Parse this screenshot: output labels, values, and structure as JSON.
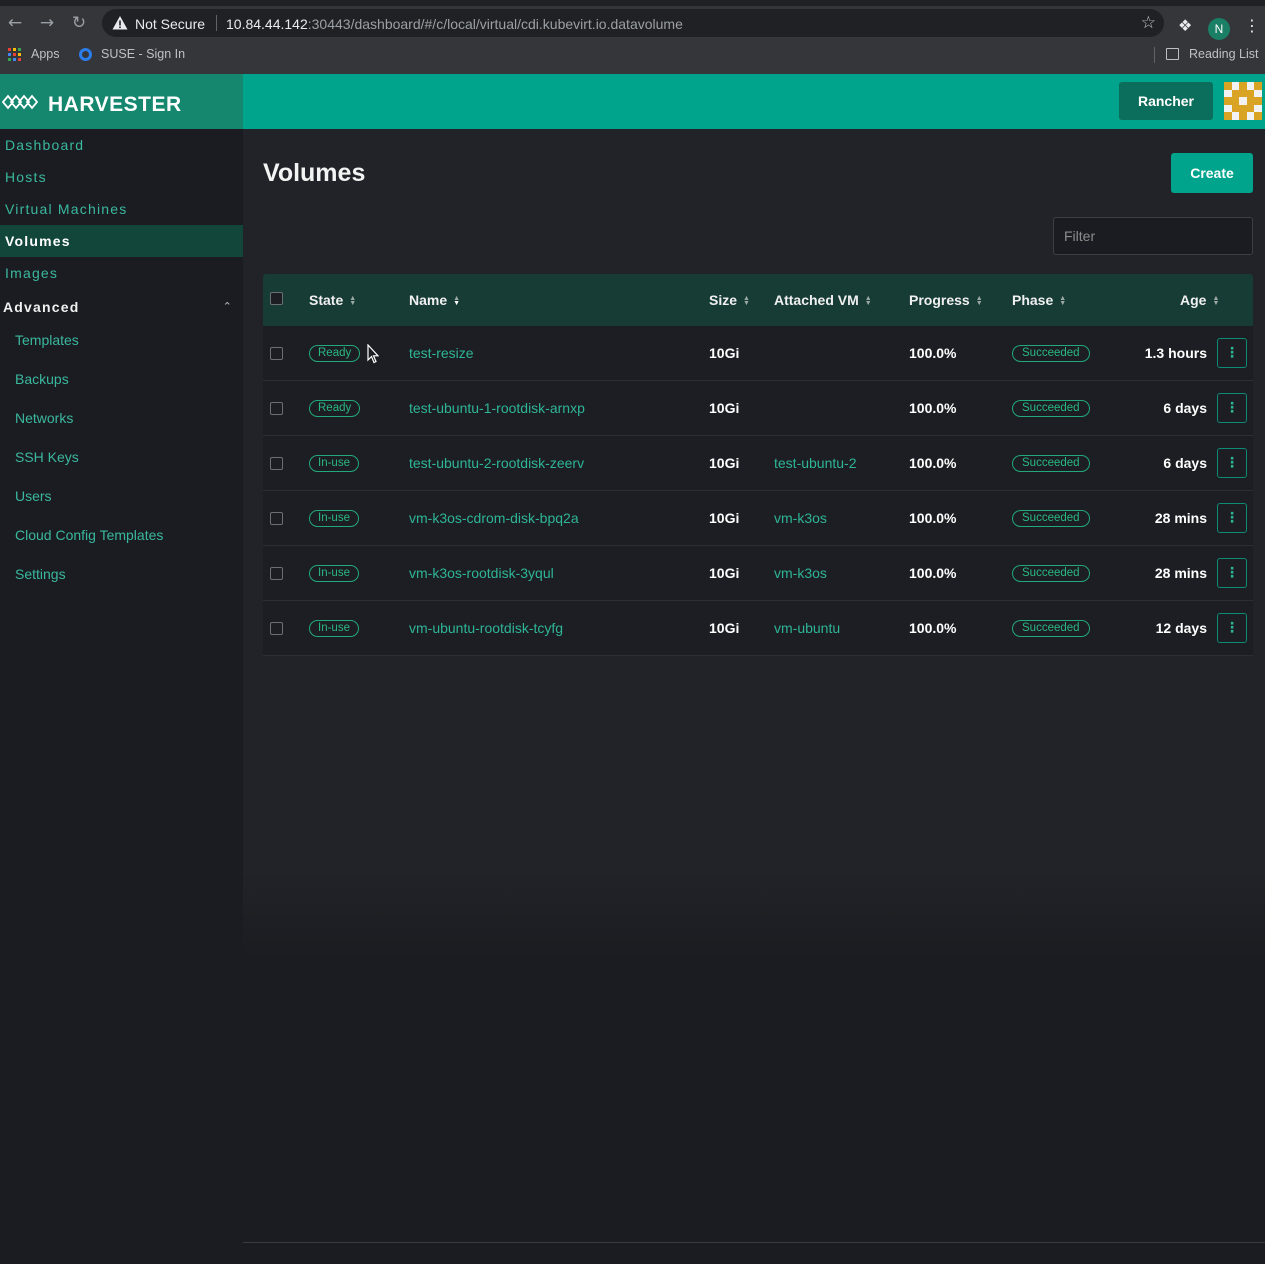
{
  "browser": {
    "security_label": "Not Secure",
    "url_host": "10.84.44.142",
    "url_rest": ":30443/dashboard/#/c/local/virtual/cdi.kubevirt.io.datavolume",
    "profile_initial": "N",
    "bookmarks": {
      "apps": "Apps",
      "suse": "SUSE - Sign In",
      "reading_list": "Reading List"
    },
    "icons": [
      "back-arrow-icon",
      "forward-arrow-icon",
      "reload-icon",
      "warning-icon",
      "star-icon",
      "extensions-icon",
      "menu-dots-icon",
      "apps-grid-icon",
      "reading-list-icon"
    ]
  },
  "app": {
    "brand": "HARVESTER",
    "rancher_label": "Rancher",
    "accent_color": "#00a38b"
  },
  "sidebar": {
    "items": [
      {
        "label": "Dashboard"
      },
      {
        "label": "Hosts"
      },
      {
        "label": "Virtual Machines"
      },
      {
        "label": "Volumes",
        "active": true
      },
      {
        "label": "Images"
      }
    ],
    "group": {
      "label": "Advanced",
      "items": [
        "Templates",
        "Backups",
        "Networks",
        "SSH Keys",
        "Users",
        "Cloud Config Templates",
        "Settings"
      ]
    }
  },
  "page": {
    "title": "Volumes",
    "create_label": "Create",
    "filter_placeholder": "Filter"
  },
  "table": {
    "columns": [
      "State",
      "Name",
      "Size",
      "Attached VM",
      "Progress",
      "Phase",
      "Age"
    ],
    "rows": [
      {
        "state": "Ready",
        "name": "test-resize",
        "size": "10Gi",
        "attached_vm": "",
        "progress": "100.0%",
        "phase": "Succeeded",
        "age": "1.3 hours"
      },
      {
        "state": "Ready",
        "name": "test-ubuntu-1-rootdisk-arnxp",
        "size": "10Gi",
        "attached_vm": "",
        "progress": "100.0%",
        "phase": "Succeeded",
        "age": "6 days"
      },
      {
        "state": "In-use",
        "name": "test-ubuntu-2-rootdisk-zeerv",
        "size": "10Gi",
        "attached_vm": "test-ubuntu-2",
        "progress": "100.0%",
        "phase": "Succeeded",
        "age": "6 days"
      },
      {
        "state": "In-use",
        "name": "vm-k3os-cdrom-disk-bpq2a",
        "size": "10Gi",
        "attached_vm": "vm-k3os",
        "progress": "100.0%",
        "phase": "Succeeded",
        "age": "28 mins"
      },
      {
        "state": "In-use",
        "name": "vm-k3os-rootdisk-3yqul",
        "size": "10Gi",
        "attached_vm": "vm-k3os",
        "progress": "100.0%",
        "phase": "Succeeded",
        "age": "28 mins"
      },
      {
        "state": "In-use",
        "name": "vm-ubuntu-rootdisk-tcyfg",
        "size": "10Gi",
        "attached_vm": "vm-ubuntu",
        "progress": "100.0%",
        "phase": "Succeeded",
        "age": "12 days"
      }
    ]
  }
}
